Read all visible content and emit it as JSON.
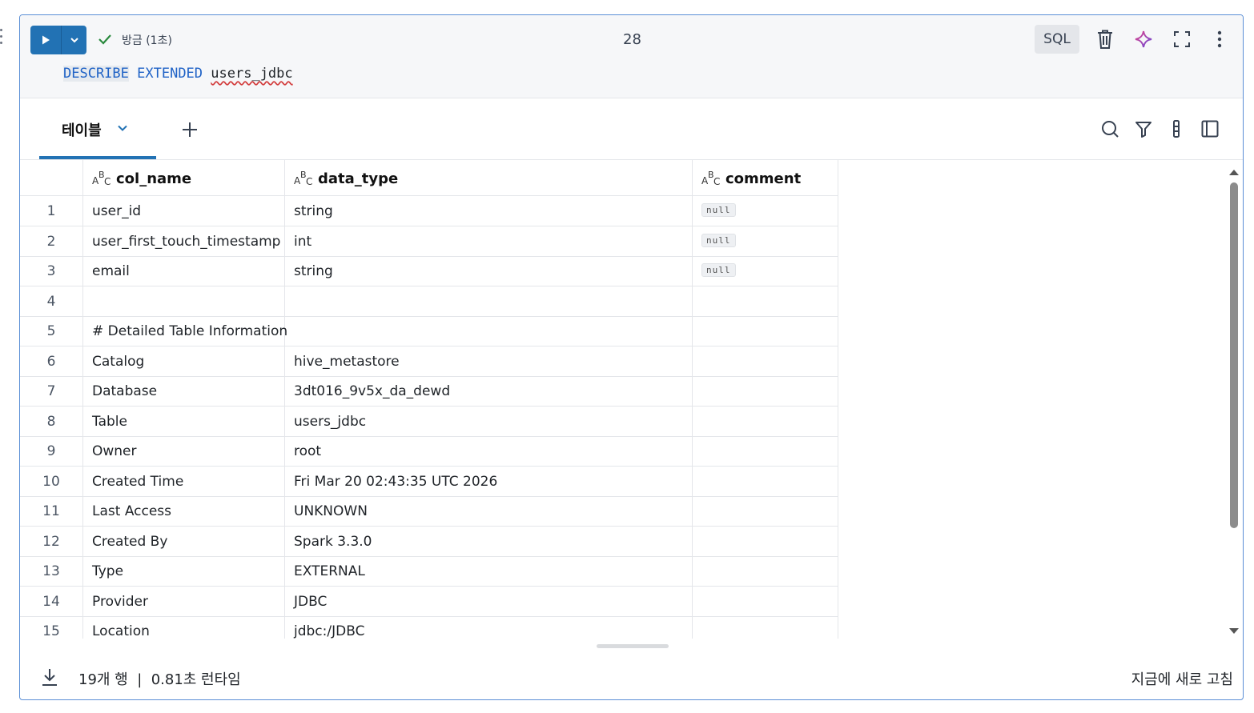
{
  "cell": {
    "status_text": "방금 (1초)",
    "exec_count": "28",
    "language": "SQL",
    "code": {
      "kw1": "DESCRIBE",
      "kw2": "EXTENDED",
      "table": "users_jdbc"
    }
  },
  "results": {
    "tab_label": "테이블",
    "columns": [
      "col_name",
      "data_type",
      "comment"
    ],
    "null_label": "null",
    "rows": [
      {
        "n": "1",
        "col_name": "user_id",
        "data_type": "string",
        "comment_null": true
      },
      {
        "n": "2",
        "col_name": "user_first_touch_timestamp",
        "data_type": "int",
        "comment_null": true
      },
      {
        "n": "3",
        "col_name": "email",
        "data_type": "string",
        "comment_null": true
      },
      {
        "n": "4",
        "col_name": "",
        "data_type": "",
        "comment_null": false
      },
      {
        "n": "5",
        "col_name": "# Detailed Table Information",
        "data_type": "",
        "comment_null": false
      },
      {
        "n": "6",
        "col_name": "Catalog",
        "data_type": "hive_metastore",
        "comment_null": false
      },
      {
        "n": "7",
        "col_name": "Database",
        "data_type": "3dt016_9v5x_da_dewd",
        "comment_null": false
      },
      {
        "n": "8",
        "col_name": "Table",
        "data_type": "users_jdbc",
        "comment_null": false
      },
      {
        "n": "9",
        "col_name": "Owner",
        "data_type": "root",
        "comment_null": false
      },
      {
        "n": "10",
        "col_name": "Created Time",
        "data_type": "Fri Mar 20 02:43:35 UTC 2026",
        "comment_null": false
      },
      {
        "n": "11",
        "col_name": "Last Access",
        "data_type": "UNKNOWN",
        "comment_null": false
      },
      {
        "n": "12",
        "col_name": "Created By",
        "data_type": "Spark 3.3.0",
        "comment_null": false
      },
      {
        "n": "13",
        "col_name": "Type",
        "data_type": "EXTERNAL",
        "comment_null": false
      },
      {
        "n": "14",
        "col_name": "Provider",
        "data_type": "JDBC",
        "comment_null": false
      },
      {
        "n": "15",
        "col_name": "Location",
        "data_type": "jdbc:/JDBC",
        "comment_null": false
      }
    ]
  },
  "footer": {
    "summary": "19개 행  |  0.81초 런타임",
    "refresh": "지금에 새로 고침"
  },
  "colors": {
    "accent": "#2272b4",
    "keyword": "#1f62c6",
    "cell_border": "#5b8fd6"
  }
}
